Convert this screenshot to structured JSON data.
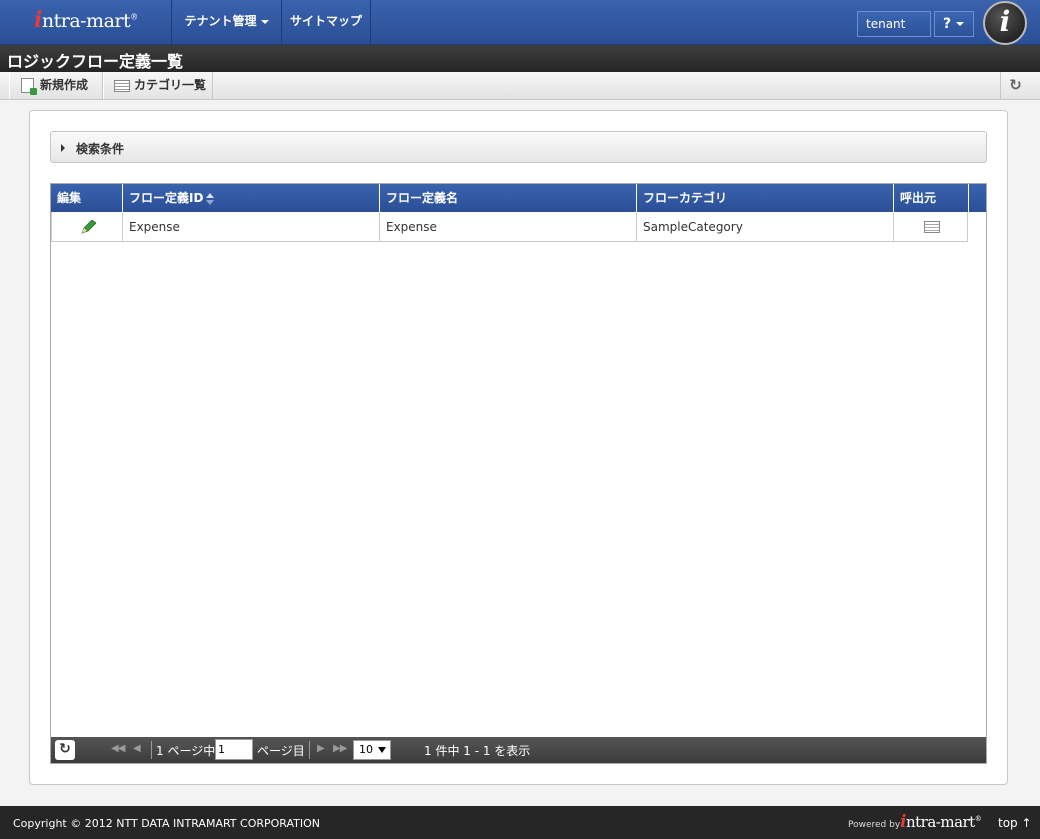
{
  "header": {
    "logo": {
      "i": "i",
      "rest": "ntra-mart",
      "reg": "®"
    },
    "nav": [
      {
        "label": "テナント管理"
      },
      {
        "label": "サイトマップ"
      }
    ],
    "user_button": "tenant",
    "help_button": "?",
    "info_glyph": "i"
  },
  "title": "ロジックフロー定義一覧",
  "toolbar": {
    "new_label": "新規作成",
    "category_label": "カテゴリ一覧",
    "refresh_glyph": "↻"
  },
  "search": {
    "label": "検索条件"
  },
  "table": {
    "columns": [
      "編集",
      "フロー定義ID",
      "フロー定義名",
      "フローカテゴリ",
      "呼出元"
    ],
    "rows": [
      {
        "id": "Expense",
        "name": "Expense",
        "category": "SampleCategory"
      }
    ]
  },
  "pager": {
    "refresh_glyph": "↻",
    "page_prefix": "1 ページ中",
    "page_value": "1",
    "page_suffix": "ページ目",
    "per_page": "10",
    "summary": "1 件中 1 - 1 を表示"
  },
  "footer": {
    "copyright": "Copyright © 2012 NTT DATA INTRAMART CORPORATION",
    "powered_by": "Powered by",
    "logo": {
      "i": "i",
      "rest": "ntra-mart",
      "reg": "®"
    },
    "top_link": "top ↑"
  },
  "colors": {
    "header_blue": "#2a4f97",
    "title_bar": "#262626",
    "footer": "#262626",
    "pencil_green": "#3a9a3a"
  }
}
